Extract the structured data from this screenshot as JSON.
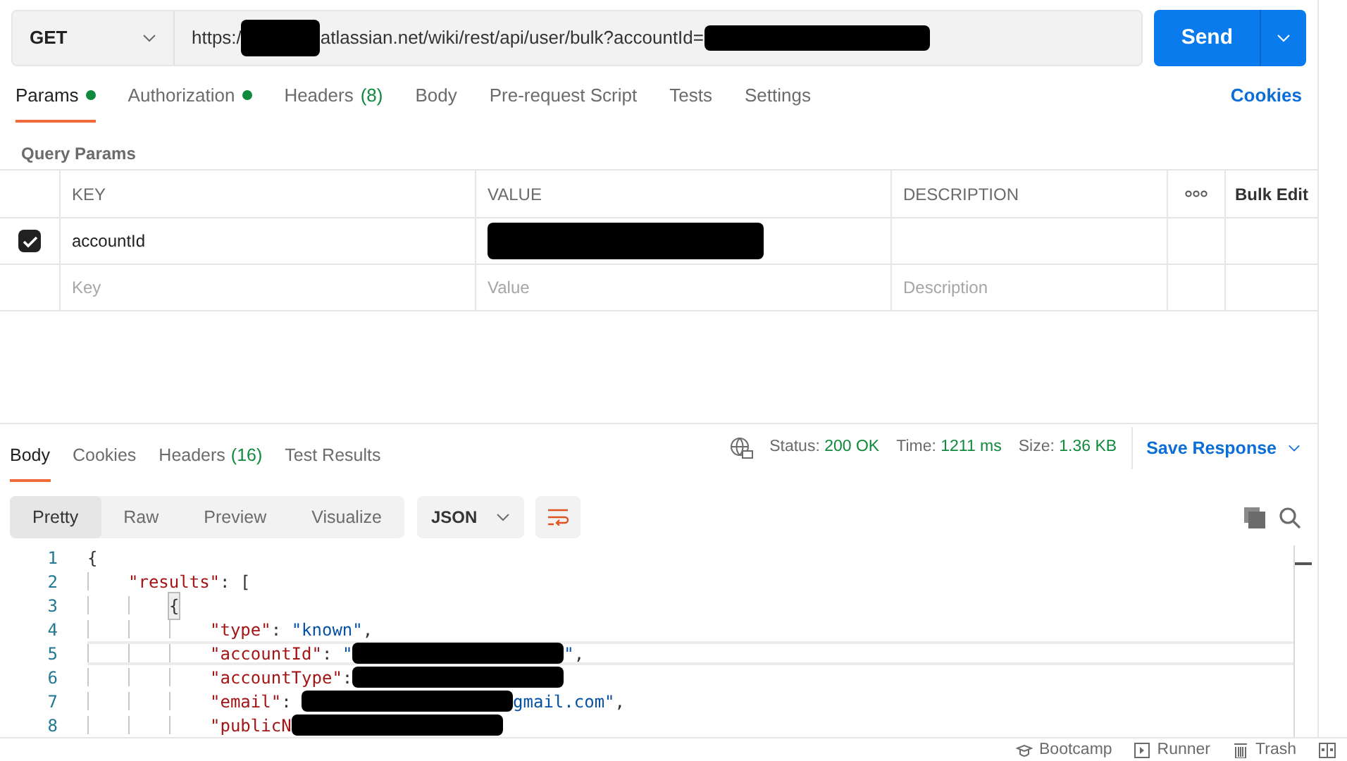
{
  "request": {
    "method": "GET",
    "url_parts": [
      {
        "kind": "text",
        "text": "https:/"
      },
      {
        "kind": "redaction"
      },
      {
        "kind": "text",
        "text": "atlassian.net/wiki/rest/api/user/bulk?accountId="
      },
      {
        "kind": "redaction"
      }
    ],
    "send": "Send"
  },
  "request_tabs": [
    {
      "label": "Params",
      "dot": true,
      "selected": true
    },
    {
      "label": "Authorization",
      "dot": true,
      "selected": false
    },
    {
      "label": "Headers",
      "count": "(8)",
      "dot": false,
      "selected": false
    },
    {
      "label": "Body",
      "dot": false,
      "selected": false
    },
    {
      "label": "Pre-request Script",
      "dot": false,
      "selected": false
    },
    {
      "label": "Tests",
      "dot": false,
      "selected": false
    },
    {
      "label": "Settings",
      "dot": false,
      "selected": false
    }
  ],
  "cookies_link": "Cookies",
  "query_params": {
    "title": "Query Params",
    "columns": [
      "KEY",
      "VALUE",
      "DESCRIPTION"
    ],
    "bulk_edit": "Bulk Edit",
    "rows": [
      {
        "checked": true,
        "key": "accountId",
        "value_redacted": true
      },
      {
        "kind": "placeholder",
        "key_placeholder": "Key",
        "value_placeholder": "Value",
        "description_placeholder": "Description"
      }
    ]
  },
  "response_tabs": [
    {
      "label": "Body",
      "selected": true
    },
    {
      "label": "Cookies",
      "selected": false
    },
    {
      "label": "Headers",
      "count": "(16)",
      "selected": false
    },
    {
      "label": "Test Results",
      "selected": false
    }
  ],
  "status": [
    {
      "label": "Status:",
      "value": "200 OK"
    },
    {
      "label": "Time:",
      "value": "1211 ms"
    },
    {
      "label": "Size:",
      "value": "1.36 KB"
    }
  ],
  "save_response": "Save Response",
  "view_modes": [
    {
      "label": "Pretty",
      "selected": true
    },
    {
      "label": "Raw",
      "selected": false
    },
    {
      "label": "Preview",
      "selected": false
    },
    {
      "label": "Visualize",
      "selected": false
    }
  ],
  "format": "JSON",
  "code_lines": [
    {
      "number": "1",
      "highlighted": false,
      "tokens": [
        {
          "kind": "punct",
          "text": "{"
        }
      ]
    },
    {
      "number": "2",
      "indent": [
        true
      ],
      "highlighted": false,
      "tokens": [
        {
          "kind": "key",
          "text": "\"results\""
        },
        {
          "kind": "punct",
          "text": ": ["
        }
      ]
    },
    {
      "number": "3",
      "indent": [
        true,
        true
      ],
      "highlighted": false,
      "tokens": [
        {
          "kind": "bracket",
          "text": "{"
        }
      ]
    },
    {
      "number": "4",
      "indent": [
        true,
        true,
        true
      ],
      "highlighted": false,
      "tokens": [
        {
          "kind": "key",
          "text": "\"type\""
        },
        {
          "kind": "punct",
          "text": ": "
        },
        {
          "kind": "string",
          "text": "\"known\""
        },
        {
          "kind": "punct",
          "text": ","
        }
      ]
    },
    {
      "number": "5",
      "indent": [
        true,
        true,
        true
      ],
      "highlighted": true,
      "tokens": [
        {
          "kind": "key",
          "text": "\"accountId\""
        },
        {
          "kind": "punct",
          "text": ": "
        },
        {
          "kind": "string",
          "text": "\""
        },
        {
          "kind": "redaction"
        },
        {
          "kind": "string",
          "text": "\""
        },
        {
          "kind": "punct",
          "text": ","
        }
      ]
    },
    {
      "number": "6",
      "indent": [
        true,
        true,
        true
      ],
      "highlighted": false,
      "tokens": [
        {
          "kind": "key",
          "text": "\"accountType\""
        },
        {
          "kind": "punct",
          "text": ":"
        },
        {
          "kind": "redaction"
        }
      ]
    },
    {
      "number": "7",
      "indent": [
        true,
        true,
        true
      ],
      "highlighted": false,
      "tokens": [
        {
          "kind": "key",
          "text": "\"email\""
        },
        {
          "kind": "punct",
          "text": ": "
        },
        {
          "kind": "redaction"
        },
        {
          "kind": "string",
          "text": "gmail.com\""
        },
        {
          "kind": "punct",
          "text": ","
        }
      ]
    },
    {
      "number": "8",
      "indent": [
        true,
        true,
        true
      ],
      "highlighted": false,
      "tokens": [
        {
          "kind": "key",
          "text": "\"publicN"
        },
        {
          "kind": "redaction"
        }
      ]
    }
  ],
  "footer": [
    "Bootcamp",
    "Runner",
    "Trash"
  ]
}
